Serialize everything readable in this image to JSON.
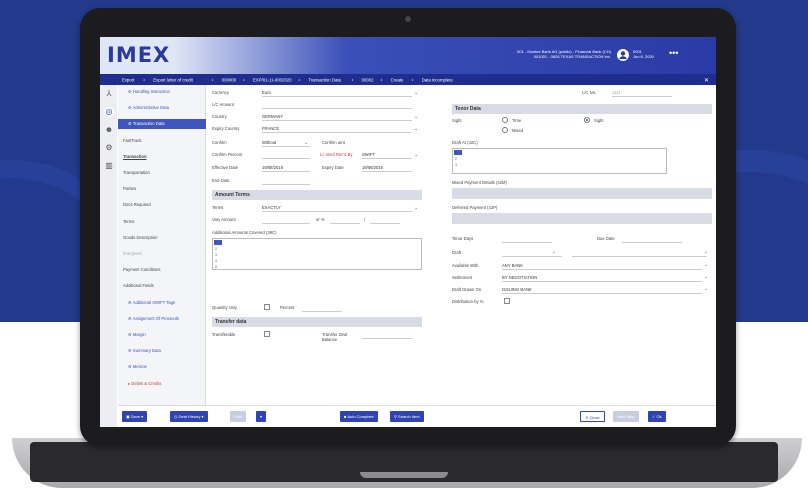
{
  "app": {
    "logo": "IMEX",
    "company_line1": "001 - Montes Bank AG (public) - Financial Bank (CH)",
    "company_line2": "001001 - 0626 TEXAS TRANSACTION Inc.",
    "user_id": "0001",
    "user_date": "Jun 8, 2020",
    "more_icon": "more-dots-icon"
  },
  "breadcrumb": [
    "Export",
    "Export letter of credit",
    "000000",
    "EXP/01-11-0002020",
    "Transaction Data",
    "00002",
    "Create",
    "Data incomplete"
  ],
  "nav": [
    {
      "label": "Handling Instruction",
      "style": "sub"
    },
    {
      "label": "Administrative Data",
      "style": "sub"
    },
    {
      "label": "Transaction Data",
      "style": "sel"
    },
    {
      "label": "FastTrack",
      "style": ""
    },
    {
      "label": "Transaction",
      "style": "bold"
    },
    {
      "label": "Transportation",
      "style": ""
    },
    {
      "label": "Parties",
      "style": ""
    },
    {
      "label": "Docs Required",
      "style": ""
    },
    {
      "label": "Terms",
      "style": ""
    },
    {
      "label": "Goods Description",
      "style": ""
    },
    {
      "label": "Evergreen",
      "style": "dim"
    },
    {
      "label": "Payment Conditions",
      "style": ""
    },
    {
      "label": "Additional Fields",
      "style": ""
    },
    {
      "label": "Additional SWIFT Tags",
      "style": "sub"
    },
    {
      "label": "Assignment Of Proceeds",
      "style": "sub"
    },
    {
      "label": "Margin",
      "style": "sub"
    },
    {
      "label": "Summary Data",
      "style": "sub"
    },
    {
      "label": "Memos",
      "style": "sub"
    },
    {
      "label": "Debits & Credits",
      "style": "red"
    }
  ],
  "form": {
    "currency_label": "Currency",
    "currency_value": "Euro",
    "lc_amount_label": "L/C Amount",
    "country_label": "Country",
    "country_value": "GERMANY",
    "expiry_country_label": "Expiry Country",
    "expiry_country_value": "FRANCE",
    "confirm_label": "Confirm",
    "confirm_value": "Without",
    "confirm_amt_label": "Confirm amt",
    "confirm_percent_label": "Confirm Percent",
    "lc_sent_label": "Lc send Rec'd By",
    "lc_sent_value": "SWIFT",
    "effective_date_label": "Effective Date",
    "effective_date_value": "19/08/2019",
    "expiry_date_label": "Expiry Date",
    "expiry_date_value": "19/08/2016",
    "end_date_label": "End Date",
    "amount_terms_title": "Amount Terms",
    "terms_label": "Terms",
    "terms_value": "EXACTLY",
    "vary_amount_label": "Vary Amount",
    "or_pct_label": "or %",
    "slash": "/",
    "additional_amounts_label": "Additional Amounts Covered (39C)",
    "quantity_vary_label": "Quantity Vary",
    "percent_label": "Percent",
    "transfer_title": "Transfer data",
    "transferable_label": "Transferable",
    "transfer_deal_label": "Transfer Deal Balance",
    "lc_no_label": "L/C No.",
    "lc_no_value": "1111",
    "tenor_title": "Tenor Data",
    "sight_label": "Sight",
    "time_label": "Time",
    "sight_option": "Sight",
    "mixed_label": "Mixed",
    "draft_at_label": "Draft At (42C)",
    "mixed_payment_label": "Mixed Payment Details (42M)",
    "deferred_payment_label": "Deferred Payment (42P)",
    "tenor_days_label": "Tenor Days",
    "due_date_label": "Due Date",
    "draft_label": "Draft",
    "available_with_label": "Available With",
    "available_with_value": "ANY BANK",
    "settlement_label": "Settlement",
    "settlement_value": "BY NEGOTIATION",
    "draft_drawn_label": "Draft Drawn On",
    "draft_drawn_value": "ISSUING BANK",
    "distribution_label": "Distribution by %"
  },
  "footer": {
    "save": "Save",
    "deal_history": "Deal History",
    "print": "Print",
    "auto_complete": "Auto Complete",
    "search_item": "Search Item",
    "close": "Close",
    "next_step": "Next Step",
    "ok": "Ok"
  },
  "colors": {
    "brand": "#2a3a9e",
    "accent": "#3f55c0",
    "header_dark": "#1f2d8f"
  }
}
